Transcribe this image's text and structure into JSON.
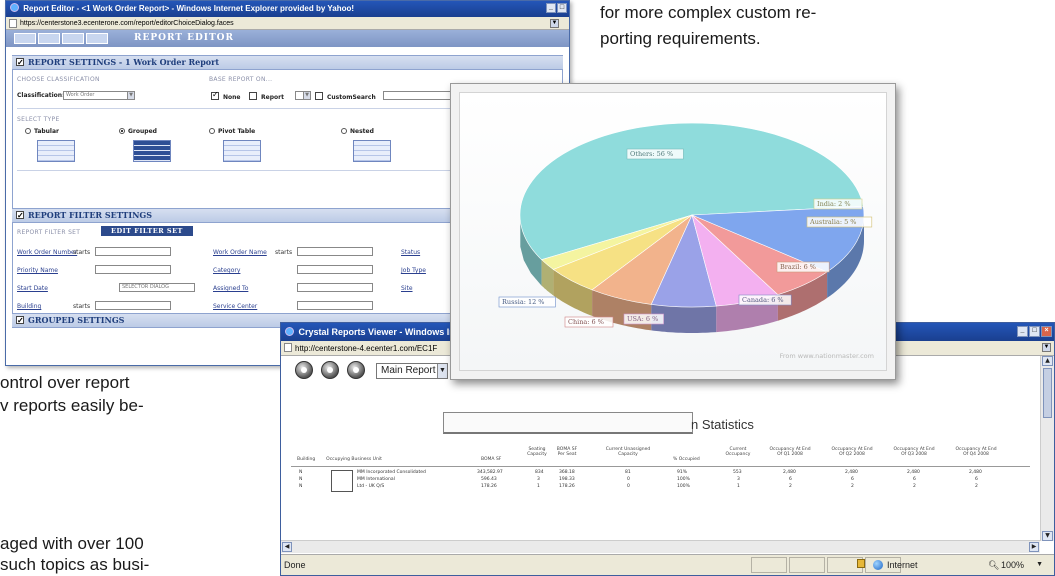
{
  "doc": {
    "right_lines": [
      "for more complex custom re-",
      "porting requirements."
    ],
    "left_lines": [
      "ontrol over report",
      "v reports easily be-",
      "",
      "aged with over 100",
      "such topics as busi-"
    ]
  },
  "editor_window": {
    "title": "Report Editor - <1 Work Order Report> - Windows Internet Explorer provided by Yahoo!",
    "url": "https://centerstone3.ecenterone.com/report/editorChoiceDialog.faces",
    "banner_title": "REPORT EDITOR",
    "settings_header": "REPORT SETTINGS - 1 Work Order Report",
    "choose_classification": "CHOOSE CLASSIFICATION",
    "classification_label": "Classification:",
    "classification_value": "Work Order",
    "base_report": "BASE REPORT ON...",
    "base_none": "None",
    "base_report_opt": "Report",
    "base_custom": "CustomSearch",
    "select_type": "SELECT TYPE",
    "types": [
      "Tabular",
      "Grouped",
      "Pivot Table",
      "Nested"
    ],
    "filter_header": "REPORT FILTER SETTINGS",
    "filter_set_label": "REPORT FILTER SET",
    "edit_filter_button": "EDIT FILTER SET",
    "filters": {
      "work_order_number": "Work Order Number",
      "work_order_name": "Work Order Name",
      "status": "Status",
      "starts": "starts",
      "priority_name": "Priority Name",
      "category": "Category",
      "job_type": "Job Type",
      "start_date": "Start Date",
      "selector_dialog": "SELECTOR DIALOG",
      "assigned_to": "Assigned To",
      "site": "Site",
      "building": "Building",
      "service_center": "Service Center"
    },
    "grouped_header": "GROUPED SETTINGS"
  },
  "chart_window": {
    "credit": "From www.nationmaster.com"
  },
  "chart_data": {
    "type": "pie",
    "title": "",
    "slices": [
      {
        "label": "Others: 56 %",
        "value": 56,
        "color": "#8fdcdc"
      },
      {
        "label": "India: 2 %",
        "value": 2,
        "color": "#f4f4a0"
      },
      {
        "label": "Australia: 5 %",
        "value": 5,
        "color": "#f6e184"
      },
      {
        "label": "Brazil: 6 %",
        "value": 6,
        "color": "#f2b38c"
      },
      {
        "label": "Canada: 6 %",
        "value": 6,
        "color": "#9aa2e8"
      },
      {
        "label": "USA: 6 %",
        "value": 6,
        "color": "#f3b0f0"
      },
      {
        "label": "China: 6 %",
        "value": 6,
        "color": "#f29a9a"
      },
      {
        "label": "Russia: 12 %",
        "value": 12,
        "color": "#7fa6ee"
      }
    ]
  },
  "crystal_window": {
    "title": "Crystal Reports Viewer - Windows In",
    "url": "http://centerstone-4.ecenter1.com/EC1F",
    "report_select": "Main Report",
    "stats_title": "n Statistics",
    "columns": [
      "Building",
      "Occupying Business Unit",
      "BOMA SF",
      "Seating Capacity",
      "BOMA SF Per Seat",
      "Current Unassigned Capacity",
      "% Occupied",
      "Current Occupancy",
      "Occupancy At End Of Q1 2008",
      "Occupancy At End Of Q2 2008",
      "Occupancy At End Of Q3 2008",
      "Occupancy At End Of Q4 2008"
    ],
    "rows": [
      [
        "N",
        "MM Incorporated Consolidated",
        "343,582.97",
        "834",
        "368.18",
        "81",
        "91%",
        "553",
        "2,480",
        "2,480",
        "2,480",
        "2,480"
      ],
      [
        "N",
        "MM International",
        "596.43",
        "3",
        "198.33",
        "0",
        "100%",
        "3",
        "6",
        "6",
        "6",
        "6"
      ],
      [
        "N",
        "Ltd - UK Q/S",
        "178.26",
        "1",
        "178.26",
        "0",
        "100%",
        "1",
        "2",
        "2",
        "2",
        "2"
      ]
    ],
    "status_left": "Done",
    "zone": "Internet",
    "zoom": "100%"
  }
}
